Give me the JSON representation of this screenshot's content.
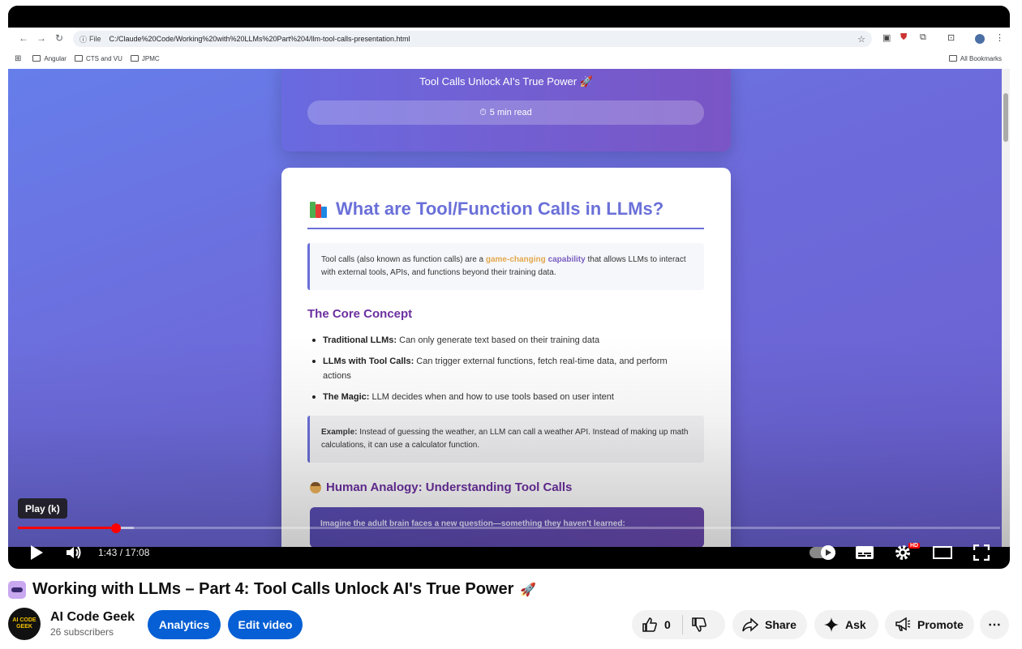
{
  "browser": {
    "file_label": "File",
    "url": "C:/Claude%20Code/Working%20with%20LLMs%20Part%204/llm-tool-calls-presentation.html",
    "bookmarks": [
      "Angular",
      "CTS and VU",
      "JPMC"
    ],
    "all_bookmarks": "All Bookmarks"
  },
  "slide": {
    "hero_title": "Tool Calls Unlock AI's True Power 🚀",
    "read_time": "5 min read",
    "heading": "What are Tool/Function Calls in LLMs?",
    "intro_pre": "Tool calls (also known as function calls) are a ",
    "intro_hl1": "game-changing",
    "intro_hl2": "capability",
    "intro_post": " that allows LLMs to interact with external tools, APIs, and functions beyond their training data.",
    "core_heading": "The Core Concept",
    "bullets": [
      {
        "term": "Traditional LLMs:",
        "text": " Can only generate text based on their training data"
      },
      {
        "term": "LLMs with Tool Calls:",
        "text": " Can trigger external functions, fetch real-time data, and perform actions"
      },
      {
        "term": "The Magic:",
        "text": " LLM decides when and how to use tools based on user intent"
      }
    ],
    "example_term": "Example:",
    "example_text": " Instead of guessing the weather, an LLM can call a weather API. Instead of making up math calculations, it can use a calculator function.",
    "analogy_heading": "Human Analogy: Understanding Tool Calls",
    "analogy_text": "Imagine the adult brain faces a new question—something they haven't learned:"
  },
  "player": {
    "tooltip": "Play (k)",
    "time": "1:43 / 17:08",
    "progress_played": 0.1,
    "hd_badge": "HD"
  },
  "video": {
    "title": "Working with LLMs – Part 4: Tool Calls Unlock AI's True Power",
    "channel_name": "AI Code Geek",
    "avatar_text": "AI CODE GEEK",
    "subscribers": "26 subscribers",
    "analytics_label": "Analytics",
    "edit_label": "Edit video",
    "like_count": "0",
    "share_label": "Share",
    "ask_label": "Ask",
    "promote_label": "Promote",
    "more_label": "⋯"
  },
  "colors": {
    "accent": "#065fd4",
    "progress": "#ff0000",
    "slide_heading": "#6a70d8",
    "slide_subheading": "#6b2fa0"
  }
}
